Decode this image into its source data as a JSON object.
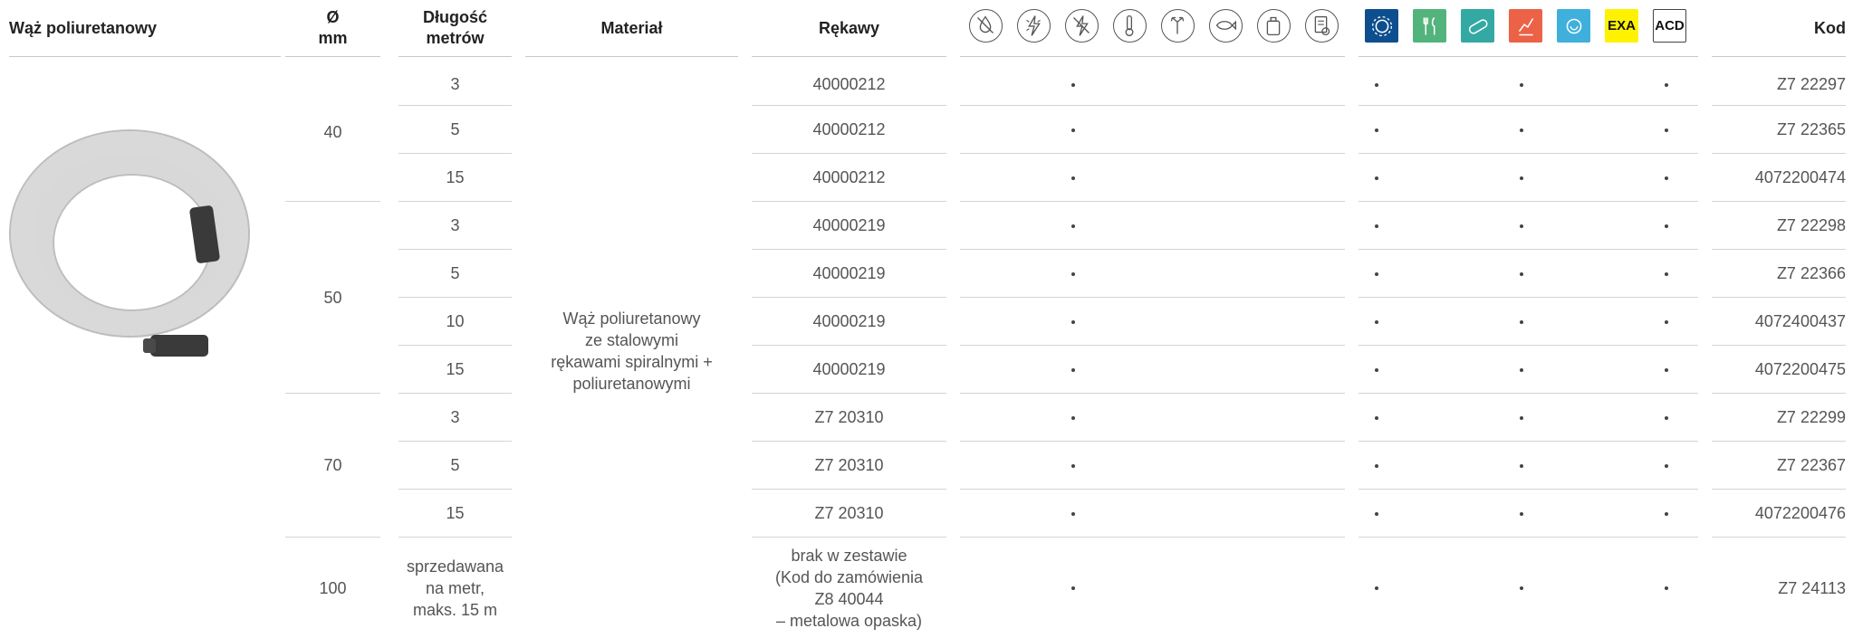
{
  "headers": {
    "product": "Wąż poliuretanowy",
    "diameter_line1": "Ø",
    "diameter_line2": "mm",
    "length_line1": "Długość",
    "length_line2": "metrów",
    "material": "Materiał",
    "sleeves": "Rękawy",
    "code": "Kod"
  },
  "property_icons": [
    "no-water-drop-icon",
    "anti-static-icon",
    "non-conductive-icon",
    "thermometer-icon",
    "flexible-arrows-icon",
    "fish-oil-icon",
    "chemical-container-icon",
    "certificate-document-icon"
  ],
  "application_badges": [
    {
      "name": "industry-gear-badge",
      "color": "#0d4f8e",
      "label": ""
    },
    {
      "name": "food-cutlery-badge",
      "color": "#52b47c",
      "label": ""
    },
    {
      "name": "pharma-pill-badge",
      "color": "#34a9a3",
      "label": ""
    },
    {
      "name": "cleaning-hand-badge",
      "color": "#ec6247",
      "label": ""
    },
    {
      "name": "water-circle-badge",
      "color": "#3fb0db",
      "label": ""
    },
    {
      "name": "exa-badge",
      "color": "#fff200",
      "label": "EXA"
    },
    {
      "name": "acd-badge",
      "color": "#ffffff",
      "label": "ACD"
    }
  ],
  "diameters": [
    {
      "value": "40",
      "rows": 3
    },
    {
      "value": "50",
      "rows": 4
    },
    {
      "value": "70",
      "rows": 3
    },
    {
      "value": "100",
      "rows": 1
    }
  ],
  "material_text": "Wąż poliuretanowy\nze stalowymi\nrękawami spiralnymi +\npoliuretanowymi",
  "rows": [
    {
      "length": "3",
      "sleeve": "40000212",
      "code": "Z7 22297"
    },
    {
      "length": "5",
      "sleeve": "40000212",
      "code": "Z7 22365"
    },
    {
      "length": "15",
      "sleeve": "40000212",
      "code": "4072200474"
    },
    {
      "length": "3",
      "sleeve": "40000219",
      "code": "Z7 22298"
    },
    {
      "length": "5",
      "sleeve": "40000219",
      "code": "Z7 22366"
    },
    {
      "length": "10",
      "sleeve": "40000219",
      "code": "4072400437"
    },
    {
      "length": "15",
      "sleeve": "40000219",
      "code": "4072200475"
    },
    {
      "length": "3",
      "sleeve": "Z7 20310",
      "code": "Z7 22299"
    },
    {
      "length": "5",
      "sleeve": "Z7 20310",
      "code": "Z7 22367"
    },
    {
      "length": "15",
      "sleeve": "Z7 20310",
      "code": "4072200476"
    },
    {
      "length": "sprzedawana\nna metr,\nmaks. 15 m",
      "sleeve": "brak w zestawie\n(Kod do zamówienia\nZ8 40044\n– metalowa opaska)",
      "code": "Z7 24113"
    }
  ],
  "row_marks": [
    "•",
    "•",
    "•",
    "•"
  ]
}
